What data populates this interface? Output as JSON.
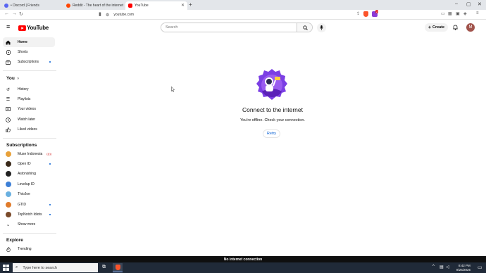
{
  "browser": {
    "tabs": [
      {
        "title": "• Discord | Friends",
        "favicon_color": "#5865f2"
      },
      {
        "title": "Reddit - The heart of the internet",
        "favicon_color": "#ff4500"
      },
      {
        "title": "YouTube",
        "favicon_color": "#ff0000"
      }
    ],
    "url": "youtube.com",
    "badge_count": "2"
  },
  "youtube": {
    "logo_text": "YouTube",
    "search_placeholder": "Search",
    "create_label": "Create",
    "avatar_letter": "M",
    "brand_color": "#ff0000"
  },
  "sidebar": {
    "main": [
      {
        "label": "Home",
        "icon": "home-icon",
        "selected": true
      },
      {
        "label": "Shorts",
        "icon": "shorts-icon"
      },
      {
        "label": "Subscriptions",
        "icon": "subscriptions-icon",
        "dot": true
      }
    ],
    "you_heading": "You",
    "you_items": [
      {
        "label": "History",
        "icon": "history-icon"
      },
      {
        "label": "Playlists",
        "icon": "playlists-icon"
      },
      {
        "label": "Your videos",
        "icon": "your-videos-icon"
      },
      {
        "label": "Watch later",
        "icon": "watch-later-icon"
      },
      {
        "label": "Liked videos",
        "icon": "like-icon"
      }
    ],
    "subscriptions_heading": "Subscriptions",
    "channels": [
      {
        "label": "Muse Indonesia",
        "color": "#e8a13a",
        "live": true
      },
      {
        "label": "Open ID",
        "color": "#3a2a1a",
        "dot": true
      },
      {
        "label": "Astonishing",
        "color": "#222222"
      },
      {
        "label": "Levelup ID",
        "color": "#3d7fd6"
      },
      {
        "label": "ThioJoe",
        "color": "#6ab0e0"
      },
      {
        "label": "GTID",
        "color": "#e07b2a",
        "dot": true
      },
      {
        "label": "TopNotch Idiots",
        "color": "#7a4a2a",
        "dot": true
      }
    ],
    "show_more": "Show more",
    "explore_heading": "Explore",
    "explore_items": [
      {
        "label": "Trending",
        "icon": "trending-icon"
      }
    ]
  },
  "offline": {
    "title": "Connect to the internet",
    "message": "You're offline. Check your connection.",
    "retry_label": "Retry"
  },
  "status_bar": "No internet connection",
  "taskbar": {
    "search_placeholder": "Type here to search",
    "time": "8:42 PM",
    "date": "8/25/2025"
  }
}
